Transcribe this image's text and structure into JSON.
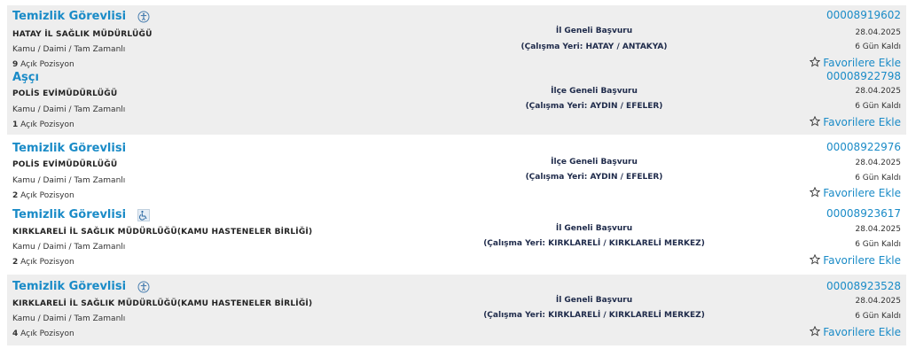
{
  "listings": [
    {
      "title": "Temizlik Görevlisi",
      "has_icon": true,
      "icon": "accessibility-icon",
      "institution": "HATAY İL SAĞLIK MÜDÜRLÜĞÜ",
      "employment": "Kamu / Daimi / Tam Zamanlı",
      "positions_count": "9",
      "positions_label": "Açık Pozisyon",
      "scope": "İl Geneli Başvuru",
      "location": "(Çalışma Yeri: HATAY / ANTAKYA)",
      "code": "00008919602",
      "date": "28.04.2025",
      "days_left": "6 Gün Kaldı",
      "favorite_label": "Favorilere Ekle"
    },
    {
      "title": "Aşçı",
      "has_icon": false,
      "icon": "",
      "institution": "POLİS EVİMÜDÜRLÜĞÜ",
      "employment": "Kamu / Daimi / Tam Zamanlı",
      "positions_count": "1",
      "positions_label": "Açık Pozisyon",
      "scope": "İlçe Geneli Başvuru",
      "location": "(Çalışma Yeri: AYDIN / EFELER)",
      "code": "00008922798",
      "date": "28.04.2025",
      "days_left": "6 Gün Kaldı",
      "favorite_label": "Favorilere Ekle"
    },
    {
      "title": "Temizlik Görevlisi",
      "has_icon": false,
      "icon": "",
      "institution": "POLİS EVİMÜDÜRLÜĞÜ",
      "employment": "Kamu / Daimi / Tam Zamanlı",
      "positions_count": "2",
      "positions_label": "Açık Pozisyon",
      "scope": "İlçe Geneli Başvuru",
      "location": "(Çalışma Yeri: AYDIN / EFELER)",
      "code": "00008922976",
      "date": "28.04.2025",
      "days_left": "6 Gün Kaldı",
      "favorite_label": "Favorilere Ekle"
    },
    {
      "title": "Temizlik Görevlisi",
      "has_icon": true,
      "icon": "wheelchair-icon",
      "institution": "KIRKLARELİ İL SAĞLIK MÜDÜRLÜĞÜ(KAMU HASTENELER BİRLİĞİ)",
      "employment": "Kamu / Daimi / Tam Zamanlı",
      "positions_count": "2",
      "positions_label": "Açık Pozisyon",
      "scope": "İl Geneli Başvuru",
      "location": "(Çalışma Yeri: KIRKLARELİ / KIRKLARELİ MERKEZ)",
      "code": "00008923617",
      "date": "28.04.2025",
      "days_left": "6 Gün Kaldı",
      "favorite_label": "Favorilere Ekle"
    },
    {
      "title": "Temizlik Görevlisi",
      "has_icon": true,
      "icon": "accessibility-icon",
      "institution": "KIRKLARELİ İL SAĞLIK MÜDÜRLÜĞÜ(KAMU HASTENELER BİRLİĞİ)",
      "employment": "Kamu / Daimi / Tam Zamanlı",
      "positions_count": "4",
      "positions_label": "Açık Pozisyon",
      "scope": "İl Geneli Başvuru",
      "location": "(Çalışma Yeri: KIRKLARELİ / KIRKLARELİ MERKEZ)",
      "code": "00008923528",
      "date": "28.04.2025",
      "days_left": "6 Gün Kaldı",
      "favorite_label": "Favorilere Ekle"
    }
  ],
  "colors": {
    "link": "#1a8bc7",
    "shaded_row": "#eeeeee",
    "location_text": "#1e2a4a"
  }
}
